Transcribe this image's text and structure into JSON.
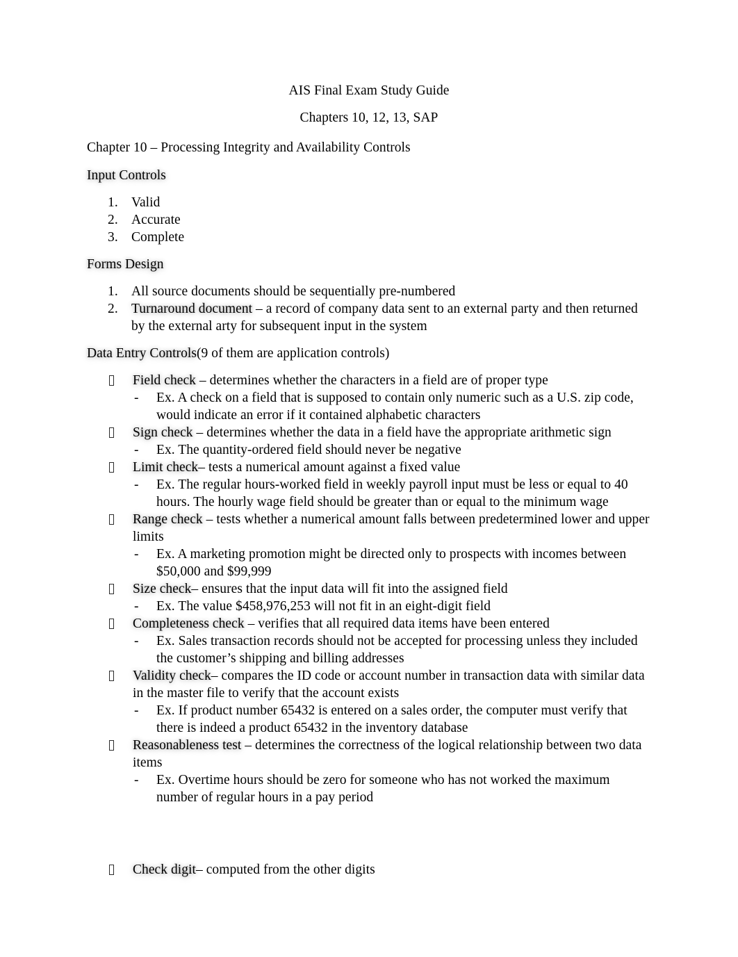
{
  "document": {
    "title_lines": [
      "AIS Final Exam Study Guide",
      "Chapters 10, 12, 13, SAP"
    ],
    "chapter_heading": "Chapter 10 – Processing Integrity and Availability Controls",
    "sections": [
      {
        "heading": "Input Controls",
        "list_type": "decimal",
        "items": [
          {
            "text": "Valid"
          },
          {
            "text": "Accurate"
          },
          {
            "text": "Complete"
          }
        ]
      },
      {
        "heading": "Forms Design",
        "list_type": "decimal",
        "items": [
          {
            "text": "All source documents should be sequentially pre-numbered"
          },
          {
            "term": "Turnaround document ",
            "text": " – a record of company data sent to an external party and then returned by the external arty for subsequent input in the system"
          }
        ]
      },
      {
        "heading": "Data Entry Controls(9 of them are application controls)",
        "heading_glow_part": "Data Entry Controls",
        "heading_rest": "(9 of them are application controls)",
        "list_type": "tofu",
        "items": [
          {
            "term": "Field check",
            "text": " – determines whether the characters in a field are of proper type",
            "examples": [
              "Ex. A check on a field that is supposed to contain only numeric such as a U.S. zip code, would indicate an error if it contained alphabetic characters"
            ]
          },
          {
            "term": "Sign check",
            "text": " – determines whether the data in a field have the appropriate arithmetic sign",
            "examples": [
              "Ex. The quantity-ordered field should never be negative"
            ]
          },
          {
            "term": "Limit check",
            "text": "– tests a numerical amount against a fixed value",
            "examples": [
              "Ex. The regular hours-worked field in weekly payroll input must be less or equal to 40 hours. The hourly wage field should be greater than or equal to the minimum wage"
            ]
          },
          {
            "term": "Range check",
            "text": " – tests whether a numerical amount falls between predetermined lower and upper limits",
            "examples": [
              "Ex. A marketing promotion might be directed only to prospects with incomes between $50,000 and $99,999"
            ]
          },
          {
            "term": "Size check",
            "text": "– ensures that the input data will fit into the assigned field",
            "examples": [
              "Ex. The value $458,976,253 will not fit in an eight-digit field"
            ]
          },
          {
            "term": "Completeness check ",
            "text": "– verifies that all required data items have been entered",
            "examples": [
              "Ex. Sales transaction records should not be accepted for processing unless they included the customer’s shipping and billing addresses"
            ]
          },
          {
            "term": "Validity check",
            "text": "– compares the ID code or account number in transaction data with similar data in the master file to verify that the account exists",
            "examples": [
              "Ex. If product number 65432 is entered on a sales order, the computer must verify that there is indeed a product 65432 in the inventory database"
            ]
          },
          {
            "term": "Reasonableness test ",
            "text": " – determines the correctness of the logical relationship between two data items",
            "examples": [
              "Ex. Overtime hours should be zero for someone who has not worked the maximum number of regular hours in a pay period"
            ]
          }
        ]
      }
    ],
    "trailing_item": {
      "term": "Check digit",
      "text": "– computed from the other digits"
    }
  }
}
